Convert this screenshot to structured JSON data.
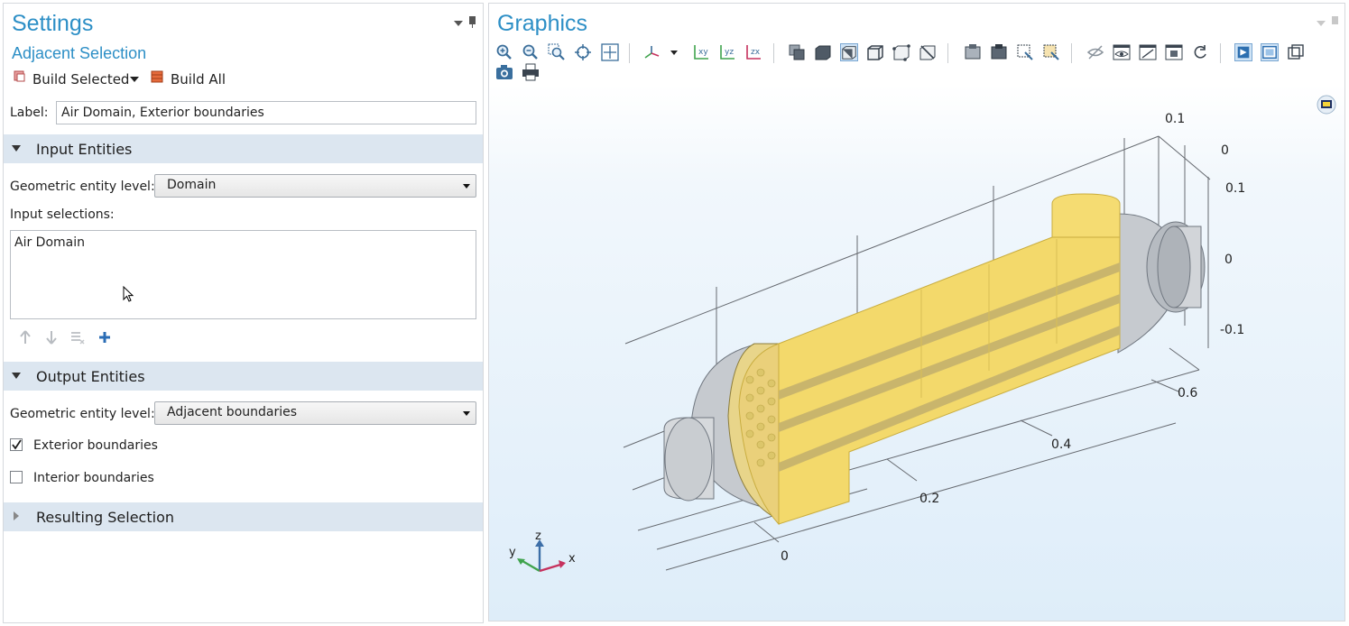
{
  "settings": {
    "title": "Settings",
    "subtitle": "Adjacent Selection",
    "build_selected": "Build Selected",
    "build_all": "Build All",
    "label_caption": "Label:",
    "label_value": "Air Domain, Exterior boundaries",
    "input_section": "Input Entities",
    "input_level_caption": "Geometric entity level:",
    "input_level_value": "Domain",
    "input_selections_caption": "Input selections:",
    "input_selections": [
      "Air Domain"
    ],
    "output_section": "Output Entities",
    "output_level_caption": "Geometric entity level:",
    "output_level_value": "Adjacent boundaries",
    "exterior_label": "Exterior boundaries",
    "exterior_checked": true,
    "interior_label": "Interior boundaries",
    "interior_checked": false,
    "resulting_section": "Resulting Selection"
  },
  "graphics": {
    "title": "Graphics",
    "toolbar_icons": [
      "zoom-in-icon",
      "zoom-out-icon",
      "zoom-box-icon",
      "zoom-selected-icon",
      "zoom-extents-icon",
      "view-axis-icon",
      "view-xy-icon",
      "view-yz-icon",
      "view-zx-icon",
      "select-objects-icon",
      "select-domains-icon",
      "select-boundaries-icon",
      "select-edges-icon",
      "select-points-icon",
      "clear-selection-icon",
      "select-all-icon",
      "deselect-all-icon",
      "select-box-icon",
      "select-inside-icon",
      "hide-icon",
      "show-icon",
      "hide-selected-icon",
      "show-selected-icon",
      "reset-hiding-icon",
      "transparency-icon",
      "wireframe-icon",
      "render-mode-icon",
      "camera-icon",
      "print-icon"
    ],
    "axis_ticks": {
      "x": [
        "0",
        "0.2",
        "0.4",
        "0.6"
      ],
      "y": [
        "0.1",
        "0"
      ],
      "z": [
        "0.1",
        "0",
        "-0.1"
      ]
    },
    "triad": {
      "x": "x",
      "y": "y",
      "z": "z"
    },
    "colors": {
      "yellow": "#f3d96b",
      "gray": "#c2c6cb",
      "accent": "#2d8fc6"
    }
  }
}
